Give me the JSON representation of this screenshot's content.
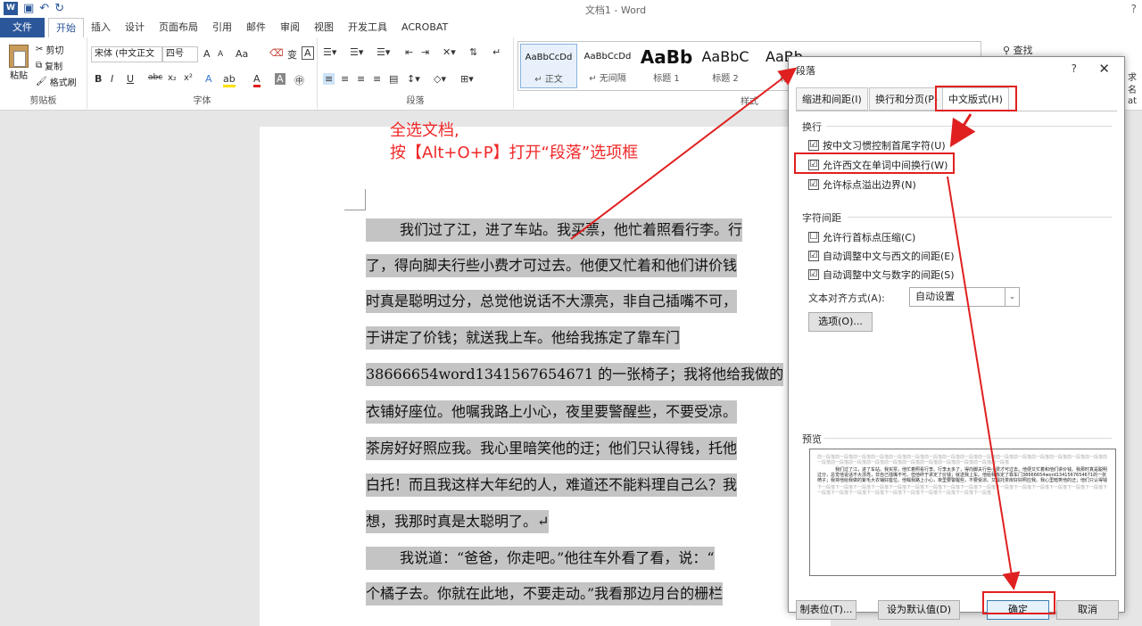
{
  "titlebar": {
    "title": "文档1 - Word",
    "help": "?"
  },
  "tabs": [
    {
      "label": "文件"
    },
    {
      "label": "开始"
    },
    {
      "label": "插入"
    },
    {
      "label": "设计"
    },
    {
      "label": "页面布局"
    },
    {
      "label": "引用"
    },
    {
      "label": "邮件"
    },
    {
      "label": "审阅"
    },
    {
      "label": "视图"
    },
    {
      "label": "开发工具"
    },
    {
      "label": "ACROBAT"
    }
  ],
  "ribbon": {
    "clipboard": {
      "paste": "粘贴",
      "cut": "剪切",
      "copy": "复制",
      "format_painter": "格式刷",
      "label": "剪贴板"
    },
    "font": {
      "name": "宋体 (中文正文",
      "size": "四号",
      "label": "字体",
      "grow": "A",
      "shrink": "A",
      "case": "Aa",
      "bold": "B",
      "italic": "I",
      "underline": "U",
      "strike": "abc",
      "sub": "x₂",
      "sup": "x²"
    },
    "paragraph": {
      "label": "段落"
    },
    "styles": {
      "label": "样式",
      "items": [
        {
          "sample": "AaBbCcDd",
          "name": "↵ 正文"
        },
        {
          "sample": "AaBbCcDd",
          "name": "↵ 无间隔"
        },
        {
          "sample": "AaBb",
          "name": "标题 1"
        },
        {
          "sample": "AaBbC",
          "name": "标题 2"
        },
        {
          "sample": "AaBb",
          "name": "标"
        }
      ]
    },
    "editing": {
      "find": "查找"
    },
    "right_cut": [
      "求",
      "名",
      "at"
    ]
  },
  "annotation": {
    "line1": "全选文档,",
    "line2": "按【Alt+O+P】打开“段落”选项框"
  },
  "document": {
    "lines": [
      "我们过了江，进了车站。我买票，他忙着照看行李。行",
      "了，得向脚夫行些小费才可过去。他便又忙着和他们讲价钱",
      "时真是聪明过分，总觉他说话不大漂亮，非自己插嘴不可，",
      "于讲定了价钱；就送我上车。他给我拣定了靠车门",
      "38666654word1341567654671 的一张椅子；我将他给我做的",
      "衣铺好座位。他嘱我路上小心，夜里要警醒些，不要受凉。",
      "茶房好好照应我。我心里暗笑他的迂；他们只认得钱，托他",
      "白托！而且我这样大年纪的人，难道还不能料理自己么？我",
      "想，我那时真是太聪明了。↵",
      "我说道：“爸爸，你走吧。”他往车外看了看，说：“",
      "个橘子去。你就在此地，不要走动。”我看那边月台的栅栏"
    ]
  },
  "dialog": {
    "title": "段落",
    "help": "?",
    "close": "✕",
    "tabs": [
      {
        "label": "缩进和间距(I)"
      },
      {
        "label": "换行和分页(P)"
      },
      {
        "label": "中文版式(H)"
      }
    ],
    "line_break": {
      "heading": "换行",
      "options": [
        {
          "label": "按中文习惯控制首尾字符(U)",
          "checked": "☑"
        },
        {
          "label": "允许西文在单词中间换行(W)",
          "checked": "☑"
        },
        {
          "label": "允许标点溢出边界(N)",
          "checked": "☑"
        }
      ]
    },
    "spacing": {
      "heading": "字符间距",
      "options": [
        {
          "label": "允许行首标点压缩(C)",
          "checked": "☐"
        },
        {
          "label": "自动调整中文与西文的间距(E)",
          "checked": "☑"
        },
        {
          "label": "自动调整中文与数字的间距(S)",
          "checked": "☑"
        }
      ],
      "align_label": "文本对齐方式(A):",
      "align_value": "自动设置",
      "options_button": "选项(O)..."
    },
    "preview": {
      "heading": "预览",
      "gray_before": "前一段落前一段落前一段落前一段落前一段落前一段落前一段落前一段落前一段落前一段落前一段落前一段落前一段落前一段落前一段落前一段落前一段落前一段落前一段落前一段落前一段落前一段落前一段落前一段落前一段落前一段落前一段落",
      "body": "我们过了江，进了车站。我买票，他忙着照看行李。行李太多了，得向脚夫行些小费才可过去。他便又忙着和他们讲价钱。我那时真是聪明过分，总觉他说话不大漂亮，非自己插嘴不可。但他终于讲定了价钱；就送我上车。他给我拣定了靠车门38666654word1341567654671的一张椅子；我将他给我做的紫毛大衣铺好座位。他嘱我路上小心，夜里要警醒些，不要受凉。又嘱托茶房好好照应我。我心里暗笑他的迂；他们只认得钱",
      "gray_after": "下一段落下一段落下一段落下一段落下一段落下一段落下一段落下一段落下一段落下一段落下一段落下一段落下一段落下一段落下一段落下一段落下一段落下一段落下一段落下一段落下一段落下一段落下一段落下一段落下一段落下一段落"
    },
    "buttons": {
      "tabs_btn": "制表位(T)...",
      "default": "设为默认值(D)",
      "ok": "确定",
      "cancel": "取消"
    }
  }
}
